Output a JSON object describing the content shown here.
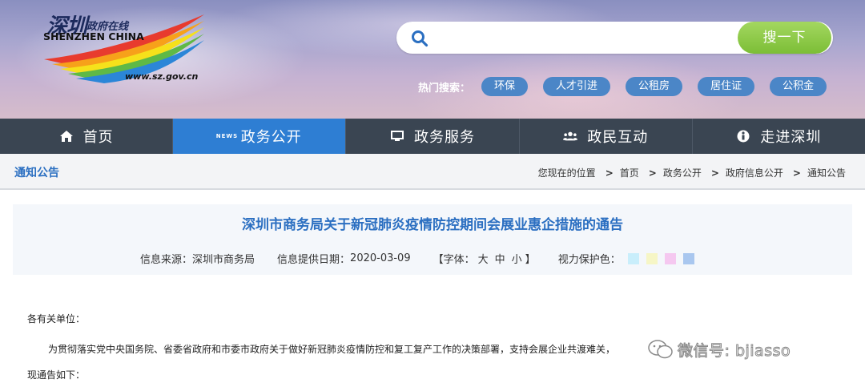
{
  "site": {
    "logo_cn_big": "深圳",
    "logo_cn_small": "政府在线",
    "logo_en": "SHENZHEN CHINA",
    "logo_url": "www.sz.gov.cn"
  },
  "search": {
    "placeholder": "",
    "button_label": "搜一下",
    "hot_label": "热门搜索：",
    "hot_tags": [
      "环保",
      "人才引进",
      "公租房",
      "居住证",
      "公积金"
    ]
  },
  "nav": {
    "items": [
      {
        "label": "首页",
        "icon": "home-icon"
      },
      {
        "label": "政务公开",
        "icon": "news-icon",
        "active": true
      },
      {
        "label": "政务服务",
        "icon": "monitor-icon"
      },
      {
        "label": "政民互动",
        "icon": "people-icon"
      },
      {
        "label": "走进深圳",
        "icon": "info-icon"
      }
    ],
    "news_icon_text": "NEWS"
  },
  "crumbbar": {
    "section_title": "通知公告",
    "location_label": "您现在的位置",
    "crumbs": [
      "首页",
      "政务公开",
      "政府信息公开",
      "通知公告"
    ],
    "separator": ">"
  },
  "article": {
    "title": "深圳市商务局关于新冠肺炎疫情防控期间会展业惠企措施的通告",
    "source_label": "信息来源：",
    "source_value": "深圳市商务局",
    "date_label": "信息提供日期：",
    "date_value": "2020-03-09",
    "font_label_open": "【字体：",
    "font_sizes": [
      "大",
      "中",
      "小"
    ],
    "font_label_close": "】",
    "eye_label": "视力保护色：",
    "eye_colors": [
      "#c9eefb",
      "#f6f6c6",
      "#f5c8f0",
      "#a9c7ef"
    ],
    "para1": "各有关单位：",
    "para2": "为贯彻落实党中央国务院、省委省政府和市委市政府关于做好新冠肺炎疫情防控和复工复产工作的决策部署，支持会展企业共渡难关，",
    "para3": "现通告如下："
  },
  "watermark": {
    "text": "微信号: bjiasso"
  },
  "colors": {
    "nav_bg": "#3a4552",
    "nav_active": "#2e7ed3",
    "search_btn": "#7cbe36",
    "hot_tag": "#4b86c7",
    "title_blue": "#2b6fc1"
  }
}
